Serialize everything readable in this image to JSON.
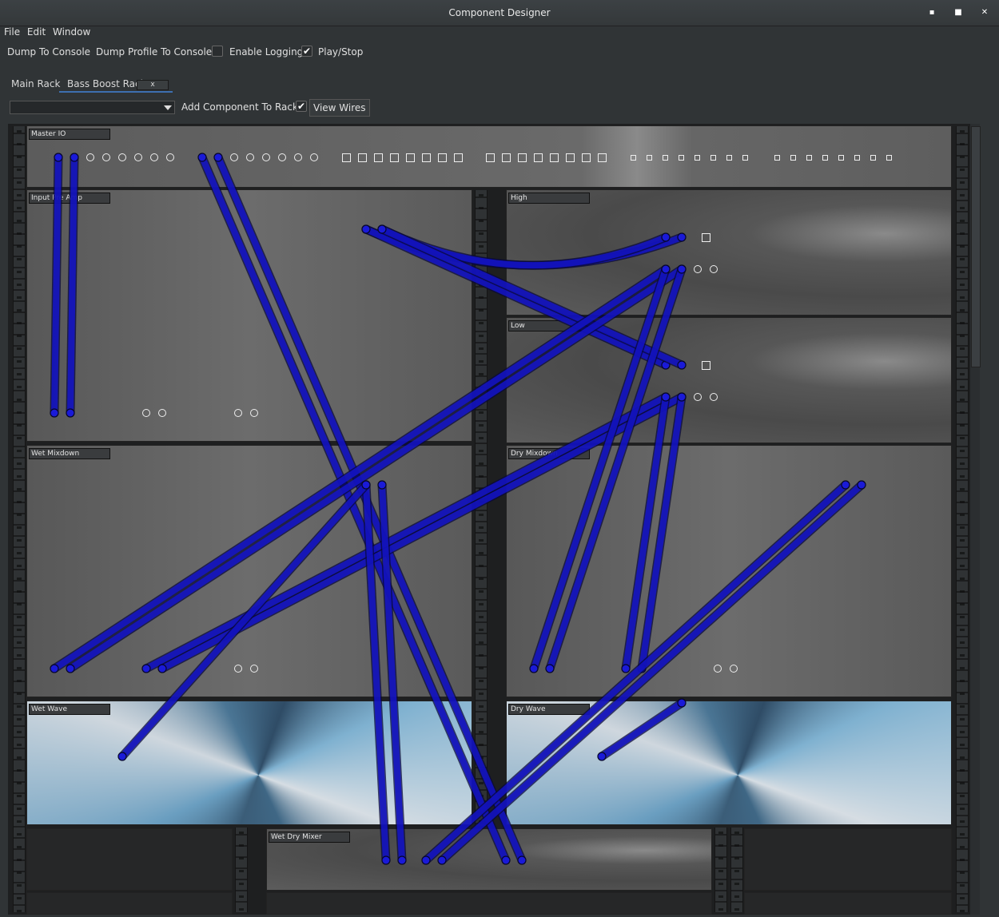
{
  "window": {
    "title": "Component Designer",
    "minimize": "▪",
    "maximize": "■",
    "close": "✕"
  },
  "menu": {
    "file": "File",
    "edit": "Edit",
    "window": "Window"
  },
  "toolbar": {
    "dump_console": "Dump To Console",
    "dump_profile": "Dump Profile To Console",
    "enable_logging": "Enable Logging",
    "enable_logging_checked": false,
    "play_stop": "Play/Stop",
    "play_stop_checked": true
  },
  "tabs": [
    {
      "label": "Main Rack",
      "active": false
    },
    {
      "label": "Bass Boost Rack",
      "active": true,
      "close": "x"
    }
  ],
  "rack_toolbar": {
    "component_select_value": "",
    "add_component": "Add Component To Rack",
    "view_wires": "View Wires",
    "view_wires_checked": true
  },
  "modules": {
    "master_io": "Master IO",
    "input_pre_amp": "Input Pre Amp",
    "high": "High",
    "low": "Low",
    "wet_mixdown": "Wet Mixdown",
    "dry_mixdown": "Dry Mixdown",
    "wet_wave": "Wet Wave",
    "dry_wave": "Dry Wave",
    "wet_dry_mixer": "Wet Dry Mixer"
  },
  "colors": {
    "wire": "#1414d2",
    "accent": "#3d6fb0"
  }
}
